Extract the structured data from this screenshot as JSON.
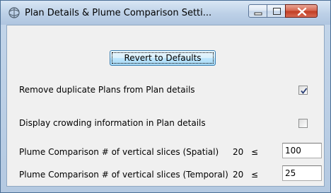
{
  "window": {
    "title": "Plan Details & Plume Comparison Setti...",
    "app_icon": "globe-app-icon",
    "controls": {
      "minimize": "minimize-icon",
      "maximize": "maximize-icon",
      "close": "close-icon",
      "close_color": "#c23e24"
    }
  },
  "toolbar": {
    "revert_label": "Revert to Defaults"
  },
  "options": {
    "remove_duplicates": {
      "label": "Remove duplicate Plans from Plan details",
      "checked": true
    },
    "display_crowding": {
      "label": "Display crowding information in Plan details",
      "checked": false
    }
  },
  "slices": {
    "spatial": {
      "label": "Plume Comparison # of vertical slices (Spatial)",
      "min": "20",
      "op": "≤",
      "value": "100"
    },
    "temporal": {
      "label": "Plume Comparison # of vertical slices (Temporal)",
      "min": "20",
      "op": "≤",
      "value": "25"
    }
  }
}
